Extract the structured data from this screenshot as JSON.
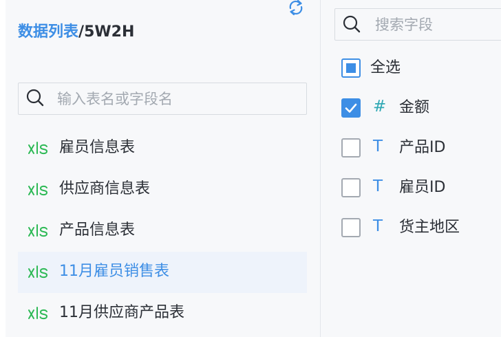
{
  "breadcrumb": {
    "link": "数据列表",
    "separator": "/",
    "current": "5W2H"
  },
  "table_search": {
    "placeholder": "输入表名或字段名",
    "value": ""
  },
  "tables": [
    {
      "icon": "xls-icon",
      "label": "雇员信息表",
      "selected": false
    },
    {
      "icon": "xls-icon",
      "label": "供应商信息表",
      "selected": false
    },
    {
      "icon": "xls-icon",
      "label": "产品信息表",
      "selected": false
    },
    {
      "icon": "xls-icon",
      "label": "11月雇员销售表",
      "selected": true
    },
    {
      "icon": "xls-icon",
      "label": "11月供应商产品表",
      "selected": false
    }
  ],
  "field_search": {
    "placeholder": "搜索字段",
    "value": ""
  },
  "select_all": {
    "label": "全选",
    "state": "partial"
  },
  "fields": [
    {
      "type_symbol": "#",
      "type": "numeric",
      "label": "金额",
      "checked": true
    },
    {
      "type_symbol": "T",
      "type": "text",
      "label": "产品ID",
      "checked": false
    },
    {
      "type_symbol": "T",
      "type": "text",
      "label": "雇员ID",
      "checked": false
    },
    {
      "type_symbol": "T",
      "type": "text",
      "label": "货主地区",
      "checked": false
    }
  ],
  "colors": {
    "accent": "#3d8ee5",
    "xls_green": "#2db955",
    "numeric_type": "#2fa8b4",
    "text": "#2b2f36",
    "placeholder": "#a3a9b1",
    "selected_row_bg": "#eef3fb",
    "panel_bg": "#f7f8fa"
  }
}
